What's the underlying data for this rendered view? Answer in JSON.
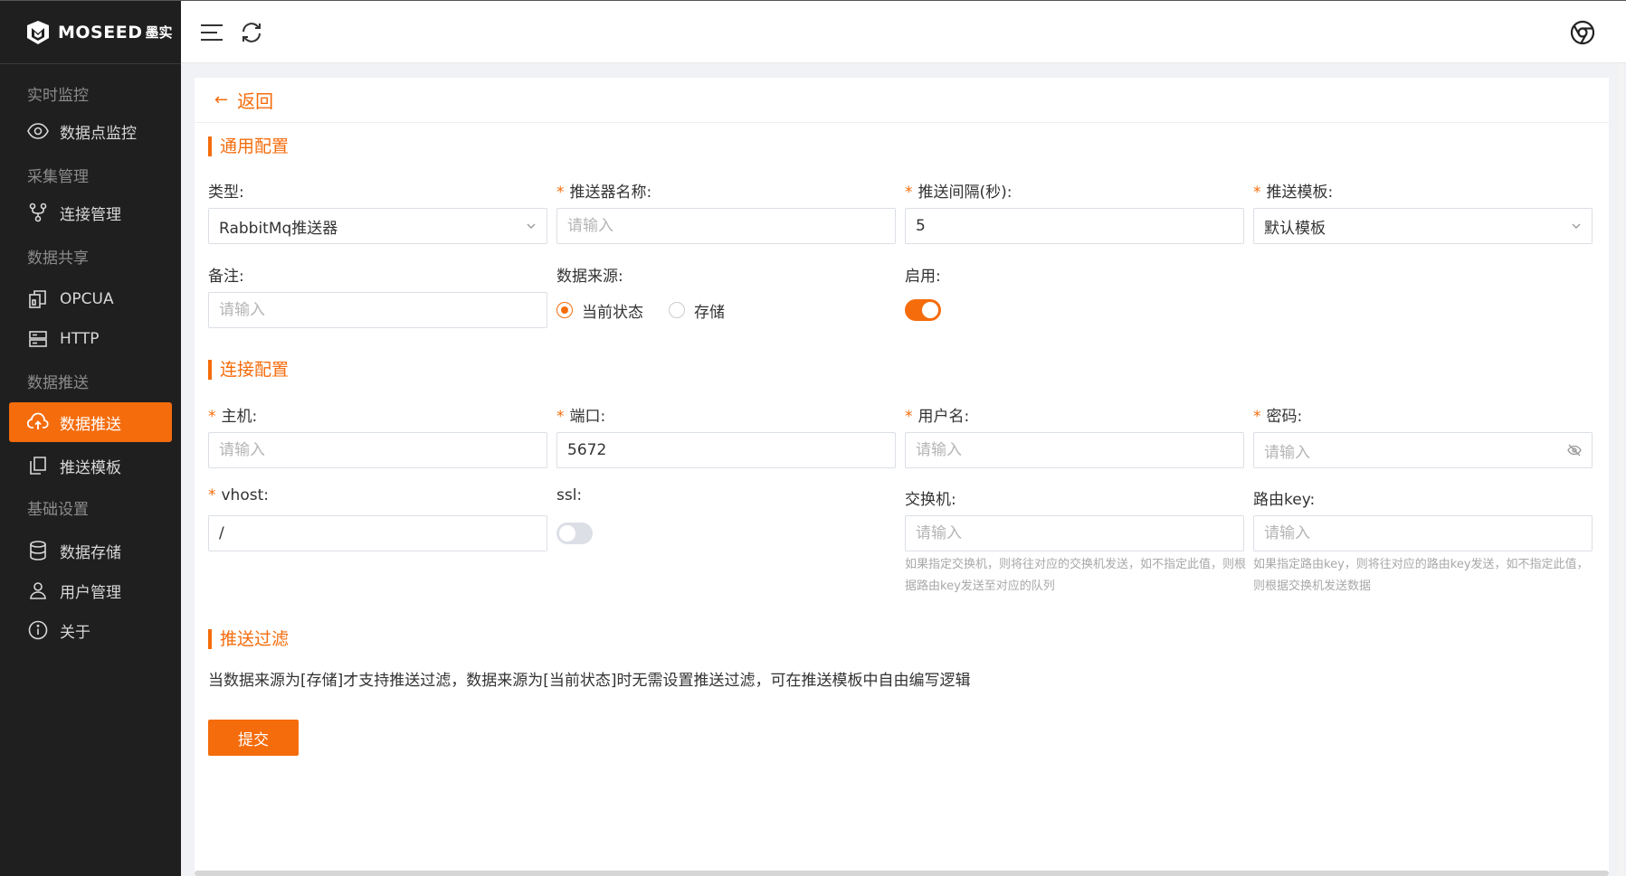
{
  "brand": {
    "name": "MOSEED",
    "sub": "墨实"
  },
  "sidebar": {
    "groups": [
      {
        "title": "实时监控",
        "items": [
          {
            "label": "数据点监控",
            "icon": "eye-icon"
          }
        ]
      },
      {
        "title": "采集管理",
        "items": [
          {
            "label": "连接管理",
            "icon": "branch-icon"
          }
        ]
      },
      {
        "title": "数据共享",
        "items": [
          {
            "label": "OPCUA",
            "icon": "copy-icon"
          },
          {
            "label": "HTTP",
            "icon": "server-icon"
          }
        ]
      },
      {
        "title": "数据推送",
        "items": [
          {
            "label": "数据推送",
            "icon": "cloud-upload-icon",
            "active": true
          },
          {
            "label": "推送模板",
            "icon": "document-icon"
          }
        ]
      },
      {
        "title": "基础设置",
        "items": [
          {
            "label": "数据存储",
            "icon": "database-icon"
          },
          {
            "label": "用户管理",
            "icon": "user-icon"
          },
          {
            "label": "关于",
            "icon": "info-icon"
          }
        ]
      }
    ]
  },
  "topbar": {
    "icons": [
      "menu-icon",
      "refresh-icon",
      "chrome-icon"
    ]
  },
  "back": {
    "label": "返回"
  },
  "sections": {
    "general": "通用配置",
    "connection": "连接配置",
    "filter": "推送过滤"
  },
  "general": {
    "type": {
      "label": "类型:",
      "value": "RabbitMq推送器"
    },
    "name": {
      "label": "推送器名称:",
      "placeholder": "请输入"
    },
    "interval": {
      "label": "推送间隔(秒):",
      "value": "5"
    },
    "template": {
      "label": "推送模板:",
      "value": "默认模板"
    },
    "remark": {
      "label": "备注:",
      "placeholder": "请输入"
    },
    "source": {
      "label": "数据来源:",
      "options": [
        "当前状态",
        "存储"
      ],
      "selected": "当前状态"
    },
    "enabled": {
      "label": "启用:",
      "value": true
    }
  },
  "connection": {
    "host": {
      "label": "主机:",
      "placeholder": "请输入"
    },
    "port": {
      "label": "端口:",
      "value": "5672"
    },
    "username": {
      "label": "用户名:",
      "placeholder": "请输入"
    },
    "password": {
      "label": "密码:",
      "placeholder": "请输入"
    },
    "vhost": {
      "label": "vhost:",
      "value": "/"
    },
    "ssl": {
      "label": "ssl:",
      "value": false
    },
    "exchange": {
      "label": "交换机:",
      "placeholder": "请输入",
      "hint": "如果指定交换机，则将往对应的交换机发送，如不指定此值，则根据路由key发送至对应的队列"
    },
    "routing_key": {
      "label": "路由key:",
      "placeholder": "请输入",
      "hint": "如果指定路由key，则将往对应的路由key发送，如不指定此值，则根据交换机发送数据"
    }
  },
  "filter_note": "当数据来源为[存储]才支持推送过滤，数据来源为[当前状态]时无需设置推送过滤，可在推送模板中自由编写逻辑",
  "submit_label": "提交",
  "colors": {
    "accent": "#f56c0c",
    "sidebar": "#1f1f1f"
  }
}
